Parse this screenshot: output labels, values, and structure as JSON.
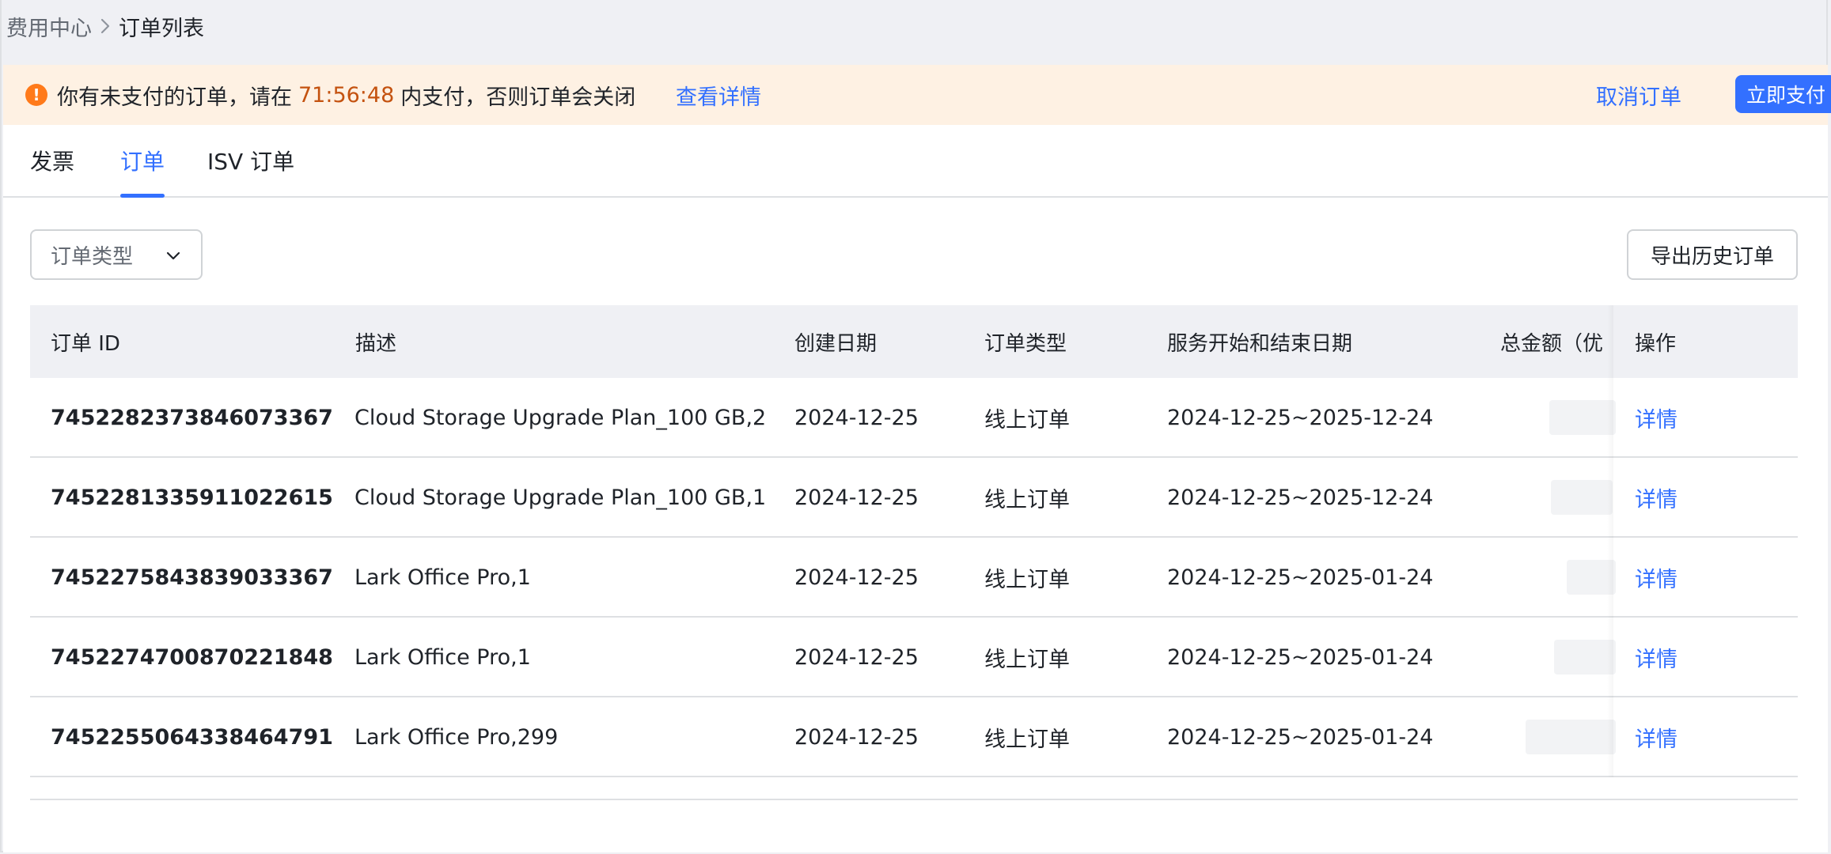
{
  "breadcrumb": {
    "parent": "费用中心",
    "current": "订单列表"
  },
  "banner": {
    "message_prefix": "你有未支付的订单，请在",
    "countdown": "71:56:48",
    "message_suffix": "内支付，否则订单会关闭",
    "details_link": "查看详情",
    "cancel_label": "取消订单",
    "pay_label": "立即支付",
    "icon": "warning-icon"
  },
  "tabs": [
    {
      "label": "发票",
      "active": false
    },
    {
      "label": "订单",
      "active": true
    },
    {
      "label": "ISV 订单",
      "active": false
    }
  ],
  "filter": {
    "label": "订单类型",
    "icon": "chevron-down-icon"
  },
  "export_label": "导出历史订单",
  "table": {
    "columns": [
      "订单 ID",
      "描述",
      "创建日期",
      "订单类型",
      "服务开始和结束日期",
      "总金额（优",
      "操作"
    ],
    "rows": [
      {
        "id": "7452282373846073367",
        "description": "Cloud Storage Upgrade Plan_100 GB,2",
        "created": "2024-12-25",
        "type": "线上订单",
        "period": "2024-12-25~2025-12-24",
        "action": "详情"
      },
      {
        "id": "7452281335911022615",
        "description": "Cloud Storage Upgrade Plan_100 GB,1",
        "created": "2024-12-25",
        "type": "线上订单",
        "period": "2024-12-25~2025-12-24",
        "action": "详情"
      },
      {
        "id": "7452275843839033367",
        "description": "Lark Office Pro,1",
        "created": "2024-12-25",
        "type": "线上订单",
        "period": "2024-12-25~2025-01-24",
        "action": "详情"
      },
      {
        "id": "7452274700870221848",
        "description": "Lark Office Pro,1",
        "created": "2024-12-25",
        "type": "线上订单",
        "period": "2024-12-25~2025-01-24",
        "action": "详情"
      },
      {
        "id": "7452255064338464791",
        "description": "Lark Office Pro,299",
        "created": "2024-12-25",
        "type": "线上订单",
        "period": "2024-12-25~2025-01-24",
        "action": "详情"
      }
    ]
  },
  "colors": {
    "primary": "#3370ff",
    "warning_bg": "#fef1e3",
    "warning_icon": "#ff7a1a",
    "countdown": "#c4520f"
  }
}
